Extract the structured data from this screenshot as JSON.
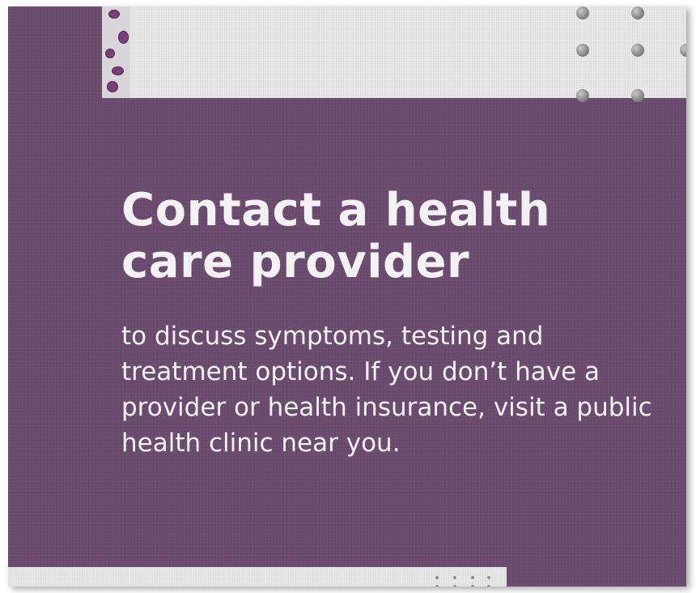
{
  "poster": {
    "heading": "Contact a health care provider",
    "body": "to discuss symptoms, testing and treatment options. If you don’t have a provider or health insurance, visit a public health clinic near you."
  },
  "colors": {
    "card_background": "#6a4b6e",
    "panel_background": "#e8e8e8",
    "text": "#f4f1f4",
    "cell_accent": "#7a3f78"
  },
  "decorations": {
    "top_left": "microscope-cells-image",
    "top_right": "dot-grid-pattern",
    "bottom": "dot-grid-pattern"
  }
}
